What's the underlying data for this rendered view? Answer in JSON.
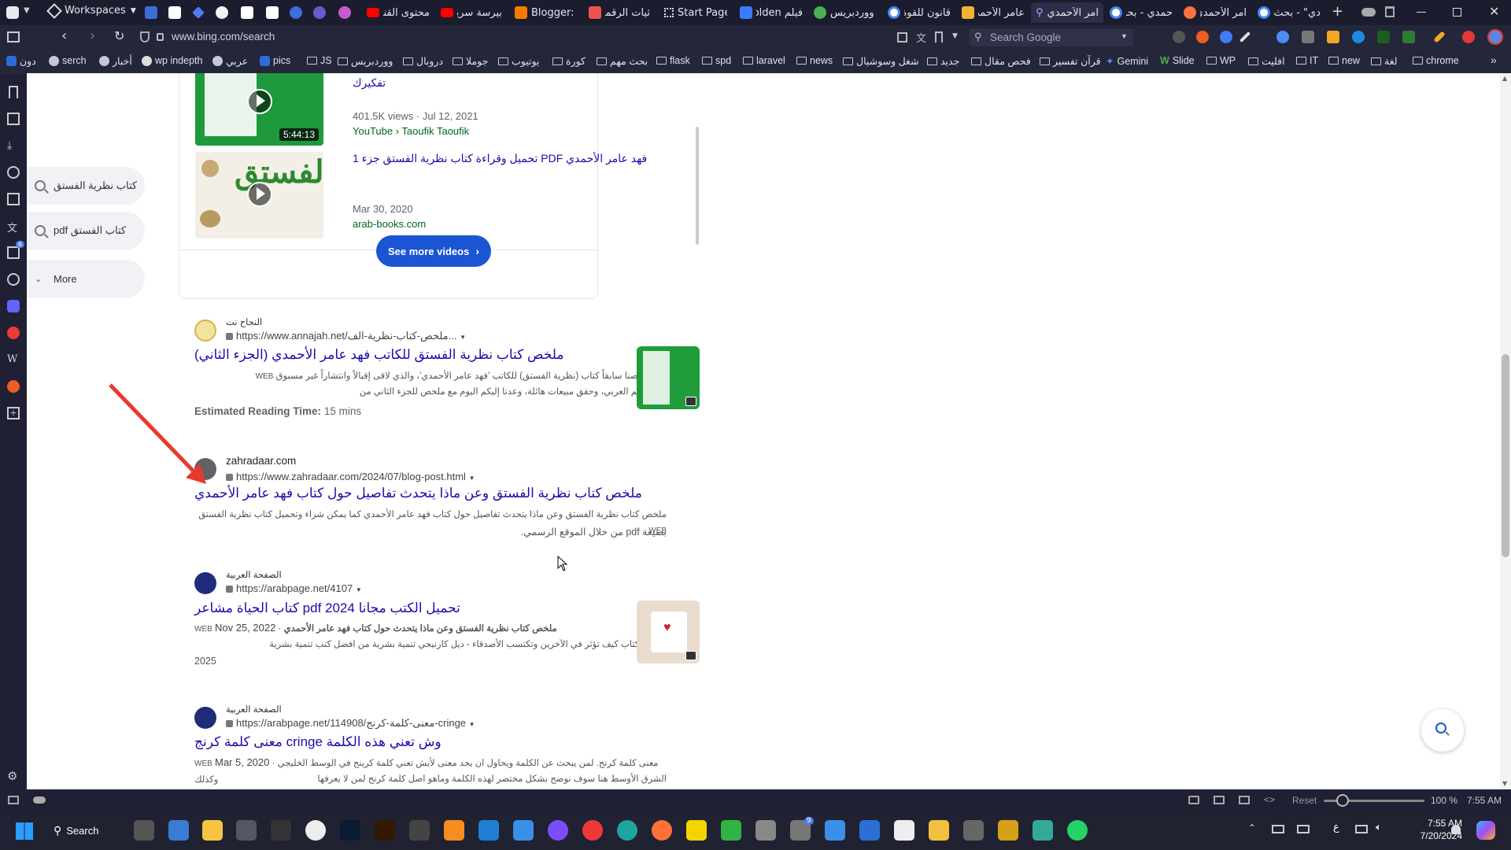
{
  "tabbar": {
    "workspaces_label": "Workspaces",
    "tabs": [
      {
        "label": "محتوى القناة",
        "color": "#ff0000"
      },
      {
        "label": "بيرسة سريعا",
        "color": "#ff0000"
      },
      {
        "label": "Blogger: ت",
        "color": "#f57c00"
      },
      {
        "label": "ثيات الرقمية",
        "color": "#ef5350"
      },
      {
        "label": "Start Page",
        "color": "#e0e0e0"
      },
      {
        "label": "فيلم Golden",
        "color": "#3b7bff"
      },
      {
        "label": "ووردبريس",
        "color": "#4caf50"
      },
      {
        "label": "قانون للقوة",
        "color": "#e0e0e0"
      },
      {
        "label": "عامر الأحمدي",
        "color": "#f2b233"
      },
      {
        "label": "امر الأحمدي",
        "color": "#9ab4ff"
      },
      {
        "label": "حمدي - بحث",
        "color": "#e0e0e0"
      },
      {
        "label": "امر الأحمدي",
        "color": "#ff7043"
      },
      {
        "label": "دي\" - بحث",
        "color": "#e0e0e0"
      }
    ]
  },
  "address": {
    "url": "www.bing.com/search",
    "search_placeholder": "Search Google"
  },
  "bookmarks": [
    "دون",
    "serch",
    "أخبار",
    "wp indepth",
    "عربي",
    "pics",
    "JS",
    "ووردبريس",
    "دروبال",
    "جوملا",
    "يوتيوب",
    "كورة",
    "بحث مهم",
    "flask",
    "spd",
    "laravel",
    "news",
    "شغل وسوشيال",
    "جديد",
    "فحص مقال",
    "قرآن تفسير",
    "Gemini",
    "Slide",
    "WP",
    "افليت",
    "IT",
    "new",
    "لغة",
    "chrome"
  ],
  "sidebar_pills": [
    {
      "label": "كتاب نظرية الفستق"
    },
    {
      "label": "كتاب الفستق pdf"
    },
    {
      "label": "More"
    }
  ],
  "videos": {
    "v1": {
      "title": "تفكيرك",
      "duration": "5:44:13",
      "meta": "401.5K views · Jul 12, 2021",
      "source": "YouTube › Taoufik Taoufik"
    },
    "v2": {
      "title": "فهد عامر الأحمدي PDF تحميل وقراءة كتاب نظرية الفستق جزء 1",
      "meta": "Mar 30, 2020",
      "source": "arab-books.com"
    },
    "see_more": "See more videos"
  },
  "results": [
    {
      "site": "النجاح نت",
      "cite": "https://www.annajah.net/ملخص-كتاب-نظرية-الف...",
      "title": "ملخص كتاب نظرية الفستق للكاتب فهد عامر الأحمدي (الجزء الثاني)",
      "snippet1": "كنّا قد لخصنا سابقاً كتاب (نظرية الفستق) للكاتب 'فهد عامر الأحمدي'، والذي لاقى إقبالاً وانتشاراً غير مسبوق",
      "snippet2": "في العالم العربي، وحقق مبيعات هائلة، وعدنا إليكم اليوم مع ملخص للجزء الثاني من",
      "web": "WEB",
      "extra_label": "Estimated Reading Time:",
      "extra_value": "15 mins"
    },
    {
      "site": "zahradaar.com",
      "cite": "https://www.zahradaar.com/2024/07/blog-post.html",
      "title": "ملخص كتاب نظرية الفستق وعن ماذا يتحدث تفاصيل حول كتاب فهد عامر الأحمدي",
      "snippet1": "ملخص كتاب نظرية الفستق وعن ماذا يتحدث تفاصيل حول كتاب فهد عامر الأحمدي كما يمكن شراء وتحميل كتاب نظرية الفستق",
      "snippet2": "بصيغة pdf من خلال الموقع الرسمي.",
      "web": "WEB"
    },
    {
      "site": "الصفحة العربية",
      "cite": "https://arabpage.net/4107",
      "title": "تحميل الكتب مجانا pdf 2024 كتاب الحياة مشاعر",
      "date": "Nov 25, 2022",
      "snippet1": "ملخص كتاب نظرية الفستق وعن ماذا يتحدث حول كتاب فهد عامر الأحمدي",
      "snippet2": "ملخص كتاب كيف تؤثر في الآخرين وتكتسب الأصدقاء - ديل كارنيجي تنمية بشرية من افضل كتب تنمية بشرية",
      "snippet3": "2025",
      "web": "WEB"
    },
    {
      "site": "الصفحة العربية",
      "cite": "https://arabpage.net/114908/معنى-كلمة-كرنج-cringe",
      "title": "وش تعني هذه الكلمة cringe معنى كلمة كرنج",
      "date": "Mar 5, 2020",
      "snippet1": "معنى كلمة كرنج. لمن يبحث عن الكلمة ويحاول ان يجد معنى لأيش تعني كلمة كرينج في الوسط الخليجي وكذلك",
      "snippet2": "الشرق الأوسط هنا سوف نوضح بشكل مختصر لهذه الكلمة وماهو اصل كلمة كرنج لمن لا يعرفها",
      "web": "WEB"
    }
  ],
  "statusbar": {
    "reset": "Reset",
    "zoom": "100 %",
    "time": "7:55 AM"
  },
  "taskbar": {
    "search": "Search",
    "lang": "ع",
    "time": "7:55 AM",
    "date": "7/20/2024",
    "badge": "9"
  },
  "rail_badge": "6",
  "colors": {
    "accent_link": "#1a0dab",
    "bing_blue": "#1a55d4",
    "annotation_arrow": "#e8392f"
  }
}
